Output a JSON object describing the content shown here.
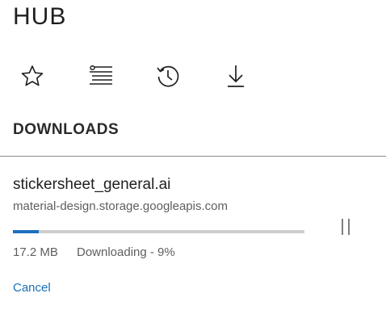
{
  "header": {
    "title": "HUB"
  },
  "tabs": [
    {
      "icon": "star-icon",
      "label": ""
    },
    {
      "icon": "reading-list-icon",
      "label": ""
    },
    {
      "icon": "history-icon",
      "label": ""
    },
    {
      "icon": "download-icon",
      "label": ""
    }
  ],
  "section": {
    "heading": "DOWNLOADS"
  },
  "download": {
    "filename": "stickersheet_general.ai",
    "source": "material-design.storage.googleapis.com",
    "progress_fraction": 0.09,
    "size": "17.2 MB",
    "status": "Downloading - 9%",
    "cancel_label": "Cancel",
    "pause_icon": "pause-icon"
  },
  "colors": {
    "accent": "#1d6fbe",
    "link": "#1b6fb5",
    "track": "#cfcfcf",
    "divider": "#8a8a8a"
  }
}
